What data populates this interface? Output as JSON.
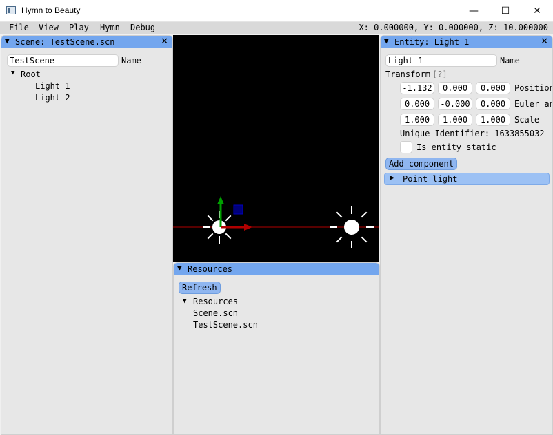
{
  "window": {
    "title": "Hymn to Beauty",
    "min_glyph": "—",
    "max_glyph": "☐",
    "close_glyph": "✕"
  },
  "menubar": {
    "items": [
      "File",
      "View",
      "Play",
      "Hymn",
      "Debug"
    ],
    "coords": "X: 0.000000, Y: 0.000000, Z: 10.000000"
  },
  "scene_panel": {
    "title": "Scene: TestScene.scn",
    "name_value": "TestScene",
    "name_label": "Name",
    "tree_root": "Root",
    "tree_children": [
      "Light 1",
      "Light 2"
    ]
  },
  "resources_panel": {
    "title": "Resources",
    "refresh_label": "Refresh",
    "tree_root": "Resources",
    "files": [
      "Scene.scn",
      "TestScene.scn"
    ]
  },
  "entity_panel": {
    "title": "Entity: Light 1",
    "name_value": "Light 1",
    "name_label": "Name",
    "transform_label": "Transform",
    "help_label": "[?]",
    "position": [
      "-1.132",
      "0.000",
      "0.000"
    ],
    "position_label": "Position",
    "euler": [
      "0.000",
      "-0.000",
      "0.000"
    ],
    "euler_label": "Euler angles",
    "scale": [
      "1.000",
      "1.000",
      "1.000"
    ],
    "scale_label": "Scale",
    "uid_text": "Unique Identifier: 1633855032",
    "static_label": "Is entity static",
    "add_component_label": "Add component",
    "component_header": "Point light"
  },
  "glyphs": {
    "expanded": "▼",
    "collapsed": "▶",
    "close": "✕"
  },
  "colors": {
    "title_active": "#73a6ee",
    "button": "#8fb6f0",
    "viewport_bg": "#000000",
    "gizmo_x": "#b00000",
    "gizmo_y": "#00a000",
    "gizmo_z": "#00007a"
  }
}
